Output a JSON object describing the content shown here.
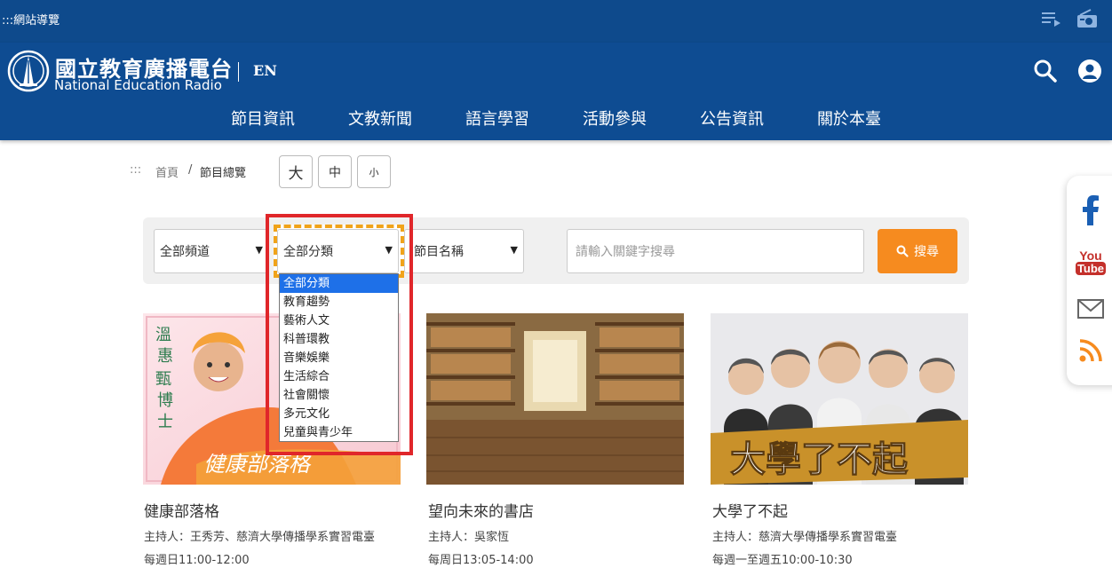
{
  "topbar": {
    "sitemap_label": ":::網站導覽",
    "icons": [
      "playlist-icon",
      "radio-icon"
    ]
  },
  "header": {
    "logo_cn": "國立教育廣播電台",
    "logo_en": "National Education Radio",
    "lang_link": "EN",
    "nav": [
      "節目資訊",
      "文教新聞",
      "語言學習",
      "活動參與",
      "公告資訊",
      "關於本臺"
    ]
  },
  "breadcrumb": {
    "dots": ":::",
    "home": "首頁",
    "separator": "/",
    "current": "節目總覽"
  },
  "font_size": {
    "large": "大",
    "medium": "中",
    "small": "小"
  },
  "filters": {
    "channel": "全部頻道",
    "category": "全部分類",
    "program": "節目名稱",
    "keyword_placeholder": "請輸入關鍵字搜尋",
    "search_label": "搜尋"
  },
  "category_options": [
    "全部分類",
    "教育趨勢",
    "藝術人文",
    "科普環教",
    "音樂娛樂",
    "生活綜合",
    "社會關懷",
    "多元文化",
    "兒童與青少年"
  ],
  "cards": [
    {
      "title": "健康部落格",
      "host": "主持人：王秀芳、慈濟大學傳播學系實習電臺",
      "time": "每週日11:00-12:00",
      "overlay_text": "健康部落格"
    },
    {
      "title": "望向未來的書店",
      "host": "主持人：吳家恆",
      "time": "每周日13:05-14:00"
    },
    {
      "title": "大學了不起",
      "host": "主持人：慈濟大學傳播學系實習電臺",
      "time": "每週一至週五10:00-10:30",
      "overlay_text": "大學了不起"
    }
  ],
  "social": {
    "youtube_line1": "You",
    "youtube_line2": "Tube"
  },
  "colors": {
    "topbar": "#0e4a8c",
    "header": "#0e4c92",
    "accent": "#f68b1f",
    "highlight": "#e0262a",
    "selected_option": "#1e70e8"
  }
}
